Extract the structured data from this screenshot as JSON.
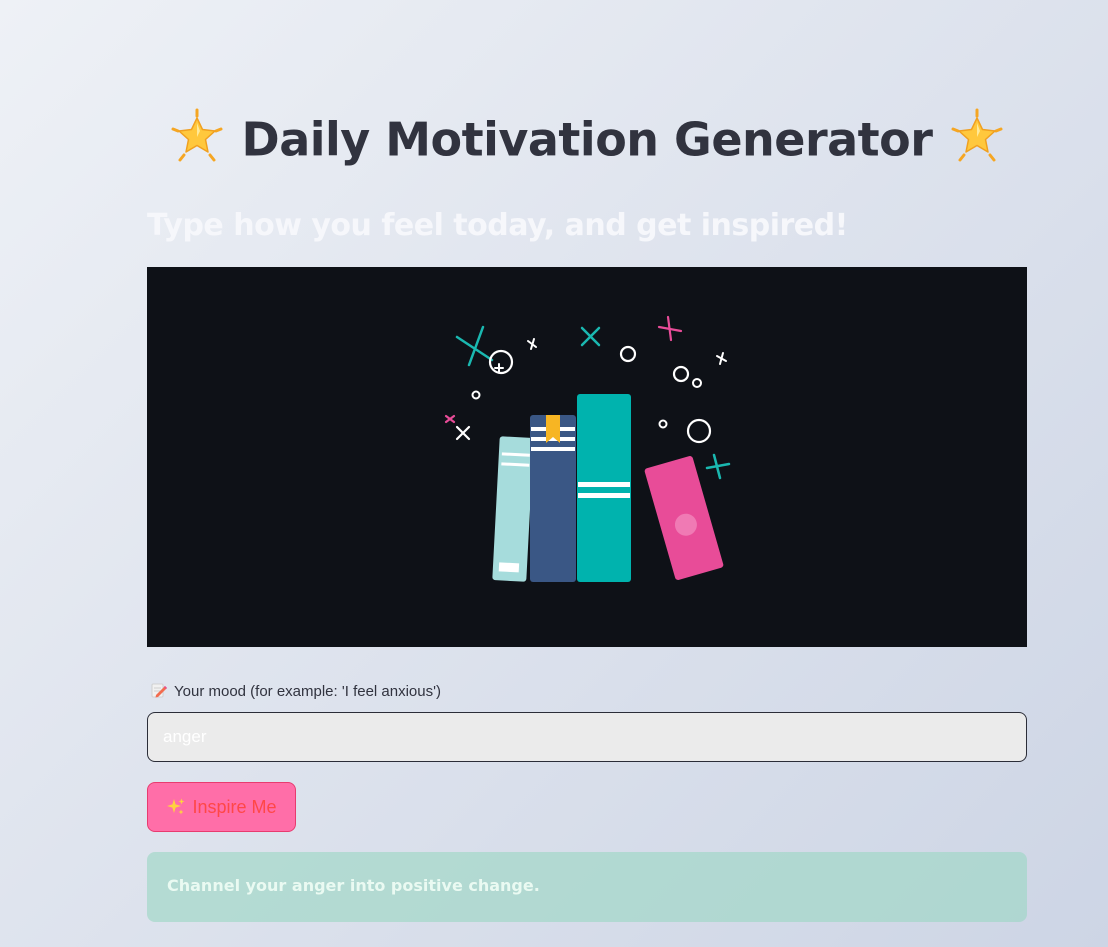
{
  "header": {
    "title": "Daily Motivation Generator",
    "title_icon": "glowing-star-emoji",
    "subtitle": "Type how you feel today, and get inspired!"
  },
  "hero": {
    "illustration": "books-icon",
    "background_color": "#0e1117"
  },
  "mood_input": {
    "label_icon": "pencil-emoji",
    "label": "Your mood (for example: 'I feel anxious')",
    "value": "anger"
  },
  "inspire_button": {
    "icon": "sparkles-emoji",
    "label": "Inspire Me"
  },
  "result": {
    "message": "Channel your anger into positive change."
  },
  "colors": {
    "title_text": "#31333f",
    "button_bg": "#ff6ea8",
    "button_text": "#ff4747",
    "result_bg": "#9bd7c3"
  }
}
